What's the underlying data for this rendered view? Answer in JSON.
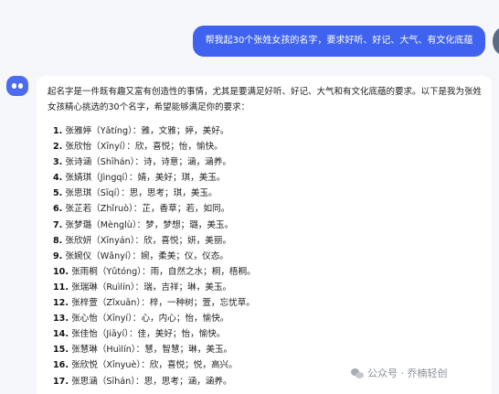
{
  "user_message": "帮我起30个张姓女孩的名字，要求好听、好记、大气、有文化底蕴",
  "bot_intro": "起名字是一件既有趣又富有创造性的事情，尤其是要满足好听、好记、大气和有文化底蕴的要求。以下是我为张姓女孩精心挑选的30个名字，希望能够满足你的要求：",
  "names": [
    {
      "num": "1.",
      "text": "张雅婷（Yǎtíng）：雅，文雅；婷，美好。"
    },
    {
      "num": "2.",
      "text": "张欣怡（Xīnyí）：欣，喜悦；怡，愉快。"
    },
    {
      "num": "3.",
      "text": "张诗涵（Shīhán）：诗，诗意；涵，涵养。"
    },
    {
      "num": "4.",
      "text": "张婧琪（Jìngqí）：婧，美好；琪，美玉。"
    },
    {
      "num": "5.",
      "text": "张思琪（Sīqí）：思，思考；琪，美玉。"
    },
    {
      "num": "6.",
      "text": "张芷若（Zhǐruò）：芷，香草；若，如同。"
    },
    {
      "num": "7.",
      "text": "张梦璐（Mènglù）：梦，梦想；璐，美玉。"
    },
    {
      "num": "8.",
      "text": "张欣妍（Xīnyán）：欣，喜悦；妍，美丽。"
    },
    {
      "num": "9.",
      "text": "张婉仪（Wǎnyí）：婉，柔美；仪，仪态。"
    },
    {
      "num": "10.",
      "text": "张雨桐（Yǔtóng）：雨，自然之水；桐，梧桐。"
    },
    {
      "num": "11.",
      "text": "张瑞琳（Ruìlín）：瑞，吉祥；琳，美玉。"
    },
    {
      "num": "12.",
      "text": "张梓萱（Zǐxuān）：梓，一种树；萱，忘忧草。"
    },
    {
      "num": "13.",
      "text": "张心怡（Xīnyí）：心，内心；怡，愉快。"
    },
    {
      "num": "14.",
      "text": "张佳怡（Jiāyí）：佳，美好；怡，愉快。"
    },
    {
      "num": "15.",
      "text": "张慧琳（Huìlín）：慧，智慧；琳，美玉。"
    },
    {
      "num": "16.",
      "text": "张欣悦（Xīnyuè）：欣，喜悦；悦，高兴。"
    },
    {
      "num": "17.",
      "text": "张思涵（Sīhán）：思，思考；涵，涵养。"
    }
  ],
  "watermark": {
    "text": "公众号 · 乔楠轻创",
    "icon": "wechat-icon"
  },
  "colors": {
    "background": "#f6f7fb",
    "user_bubble": "#3f63ee",
    "card": "#ffffff",
    "bot_avatar": "#4b6cf0"
  }
}
